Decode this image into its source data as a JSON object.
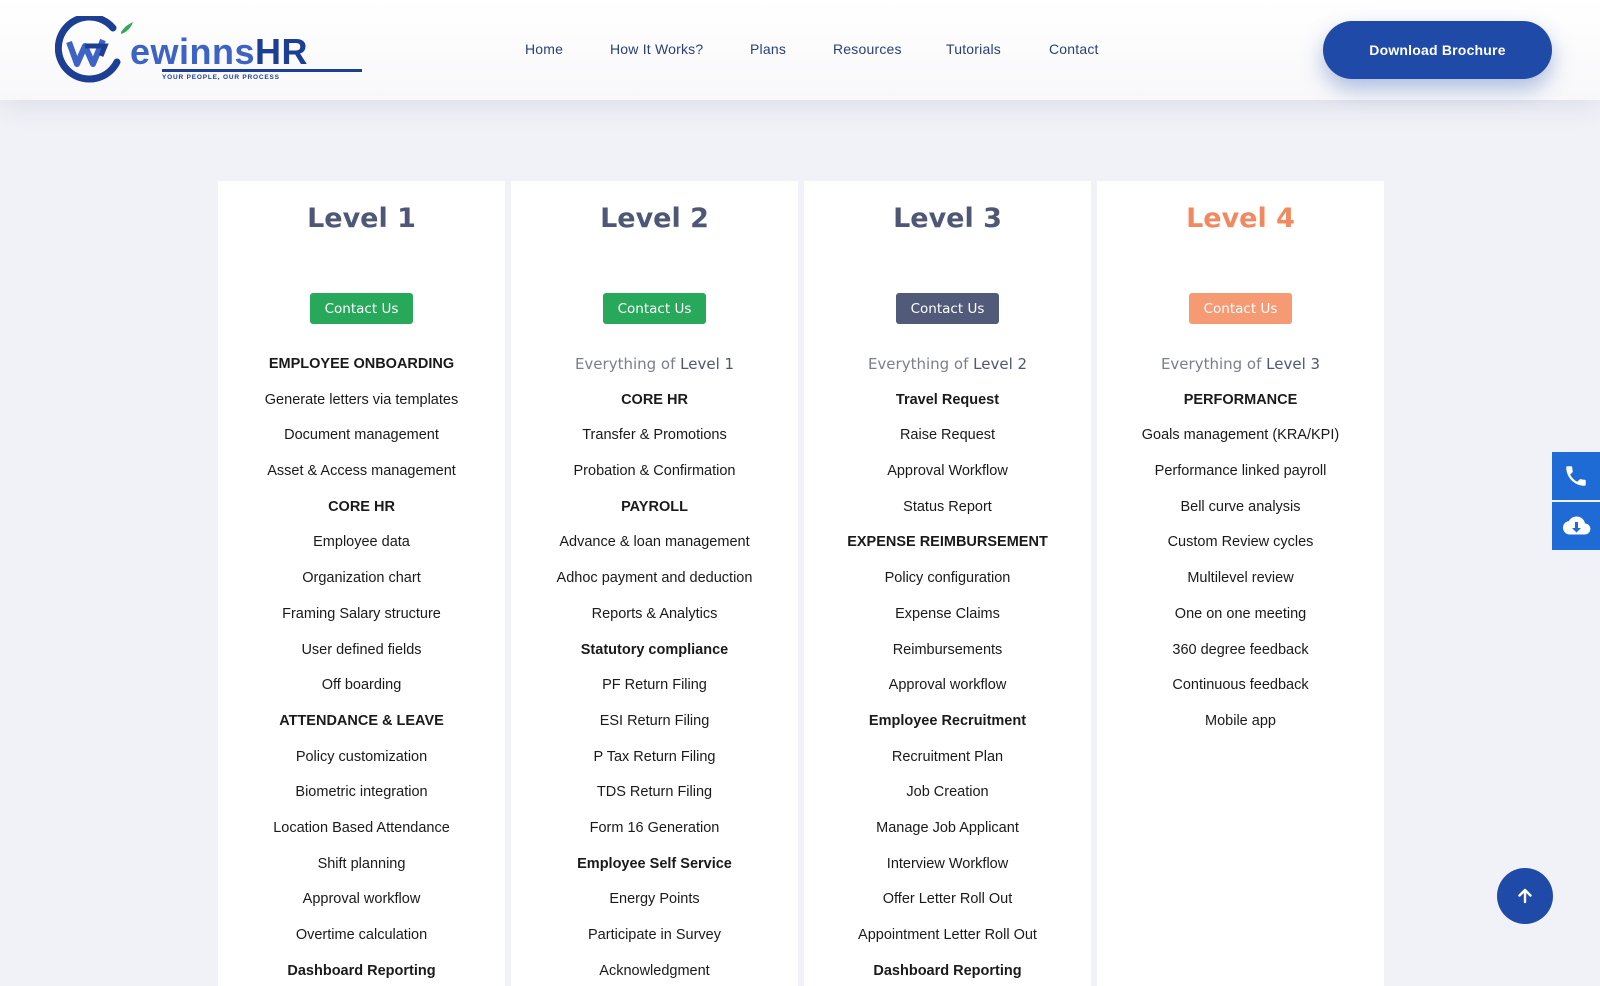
{
  "brand": {
    "logo_text_part1": "ewinns",
    "logo_text_part2": "HR",
    "tagline": "YOUR PEOPLE, OUR PROCESS"
  },
  "nav": {
    "items": [
      {
        "label": "Home"
      },
      {
        "label": "How It Works?"
      },
      {
        "label": "Plans"
      },
      {
        "label": "Resources"
      },
      {
        "label": "Tutorials"
      },
      {
        "label": "Contact"
      }
    ]
  },
  "header": {
    "cta_label": "Download Brochure"
  },
  "colors": {
    "primary": "#1f4aa8",
    "green": "#27a85a",
    "slate": "#525a7a",
    "orange": "#f69a74",
    "side_blue": "#1e6bd6"
  },
  "plans": [
    {
      "title": "Level 1",
      "button_label": "Contact Us",
      "features": [
        {
          "text": "EMPLOYEE ONBOARDING",
          "bold": true
        },
        {
          "text": "Generate letters via templates"
        },
        {
          "text": "Document management"
        },
        {
          "text": "Asset & Access management"
        },
        {
          "text": "CORE HR",
          "bold": true
        },
        {
          "text": "Employee data"
        },
        {
          "text": "Organization chart"
        },
        {
          "text": "Framing Salary structure"
        },
        {
          "text": "User defined fields"
        },
        {
          "text": "Off boarding"
        },
        {
          "text": "ATTENDANCE & LEAVE",
          "bold": true
        },
        {
          "text": "Policy customization"
        },
        {
          "text": "Biometric integration"
        },
        {
          "text": "Location Based Attendance"
        },
        {
          "text": "Shift planning"
        },
        {
          "text": "Approval workflow"
        },
        {
          "text": "Overtime calculation"
        },
        {
          "text": "Dashboard Reporting",
          "bold": true
        }
      ]
    },
    {
      "title": "Level 2",
      "button_label": "Contact Us",
      "everything_of": "Everything of",
      "everything_level": "Level 1",
      "features": [
        {
          "text": "CORE HR",
          "bold": true
        },
        {
          "text": "Transfer & Promotions"
        },
        {
          "text": "Probation & Confirmation"
        },
        {
          "text": "PAYROLL",
          "bold": true
        },
        {
          "text": "Advance & loan management"
        },
        {
          "text": "Adhoc payment and deduction"
        },
        {
          "text": "Reports & Analytics"
        },
        {
          "text": "Statutory compliance",
          "bold": true
        },
        {
          "text": "PF Return Filing"
        },
        {
          "text": "ESI Return Filing"
        },
        {
          "text": "P Tax Return Filing"
        },
        {
          "text": "TDS Return Filing"
        },
        {
          "text": "Form 16 Generation"
        },
        {
          "text": "Employee Self Service",
          "bold": true
        },
        {
          "text": "Energy Points"
        },
        {
          "text": "Participate in Survey"
        },
        {
          "text": "Acknowledgment"
        }
      ]
    },
    {
      "title": "Level 3",
      "button_label": "Contact Us",
      "everything_of": "Everything of",
      "everything_level": "Level 2",
      "features": [
        {
          "text": "Travel Request",
          "bold": true
        },
        {
          "text": "Raise Request"
        },
        {
          "text": "Approval Workflow"
        },
        {
          "text": "Status Report"
        },
        {
          "text": "EXPENSE REIMBURSEMENT",
          "bold": true
        },
        {
          "text": "Policy configuration"
        },
        {
          "text": "Expense Claims"
        },
        {
          "text": "Reimbursements"
        },
        {
          "text": "Approval workflow"
        },
        {
          "text": "Employee Recruitment",
          "bold": true
        },
        {
          "text": "Recruitment Plan"
        },
        {
          "text": "Job Creation"
        },
        {
          "text": "Manage Job Applicant"
        },
        {
          "text": "Interview Workflow"
        },
        {
          "text": "Offer Letter Roll Out"
        },
        {
          "text": "Appointment Letter Roll Out"
        },
        {
          "text": "Dashboard Reporting",
          "bold": true
        }
      ]
    },
    {
      "title": "Level 4",
      "button_label": "Contact Us",
      "everything_of": "Everything of",
      "everything_level": "Level 3",
      "features": [
        {
          "text": "PERFORMANCE",
          "bold": true
        },
        {
          "text": "Goals management (KRA/KPI)"
        },
        {
          "text": "Performance linked payroll"
        },
        {
          "text": "Bell curve analysis"
        },
        {
          "text": "Custom Review cycles"
        },
        {
          "text": "Multilevel review"
        },
        {
          "text": "One on one meeting"
        },
        {
          "text": "360 degree feedback"
        },
        {
          "text": "Continuous feedback"
        },
        {
          "text": "Mobile app"
        }
      ]
    }
  ]
}
